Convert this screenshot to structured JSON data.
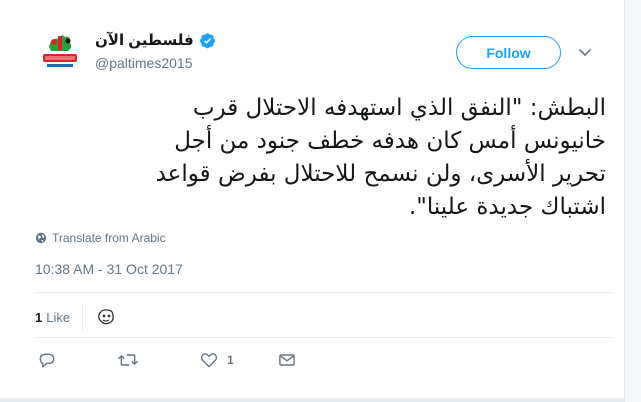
{
  "header": {
    "display_name": "فلسطين الآن",
    "handle": "@paltimes2015",
    "avatar_icon": "paltimes-logo",
    "verified_icon": "verified-badge-icon"
  },
  "follow": {
    "label": "Follow"
  },
  "tweet": {
    "lines": [
      "البطش: \"النفق الذي استهدفه الاحتلال قرب",
      "خانيونس أمس كان هدفه خطف جنود من أجل",
      "تحرير الأسرى، ولن نسمح للاحتلال بفرض قواعد",
      "اشتباك جديدة علينا\"."
    ]
  },
  "translate": {
    "label": "Translate from Arabic"
  },
  "timestamp": "10:38 AM - 31 Oct 2017",
  "stats": {
    "likes_count": "1",
    "likes_label": "Like"
  },
  "actions": {
    "reply_count": "",
    "retweet_count": "",
    "like_count": "1"
  },
  "colors": {
    "accent": "#1da1f2",
    "muted": "#657786",
    "text": "#14171a",
    "border": "#e6ecf0"
  }
}
